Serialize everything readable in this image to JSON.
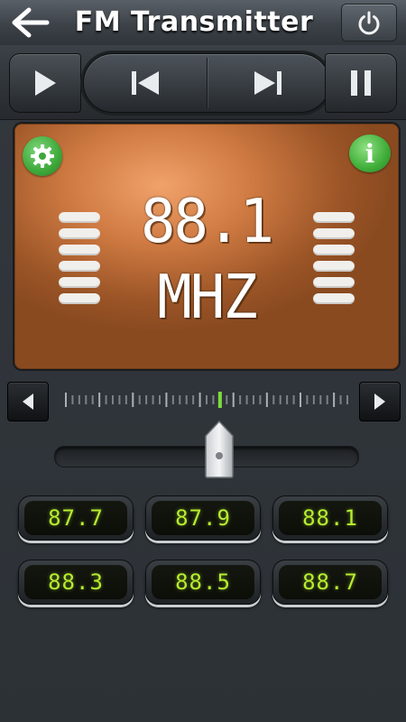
{
  "header": {
    "title": "FM Transmitter",
    "back_icon": "arrow-left-icon",
    "power_icon": "power-icon"
  },
  "transport": {
    "play_icon": "play-icon",
    "prev_icon": "skip-previous-icon",
    "next_icon": "skip-next-icon",
    "pause_icon": "pause-icon"
  },
  "display": {
    "frequency": "88.1 MHZ",
    "settings_icon": "gear-icon",
    "info_label": "i",
    "background_color": "#cf7a42"
  },
  "tuner": {
    "left_icon": "triangle-left-icon",
    "right_icon": "triangle-right-icon",
    "slider_position_fraction": 0.54,
    "indicator_color": "#7ddc3a"
  },
  "presets": [
    "87.7",
    "87.9",
    "88.1",
    "88.3",
    "88.5",
    "88.7"
  ],
  "colors": {
    "lcd_text": "#b6ec2f",
    "accent_green": "#3ea83a"
  }
}
